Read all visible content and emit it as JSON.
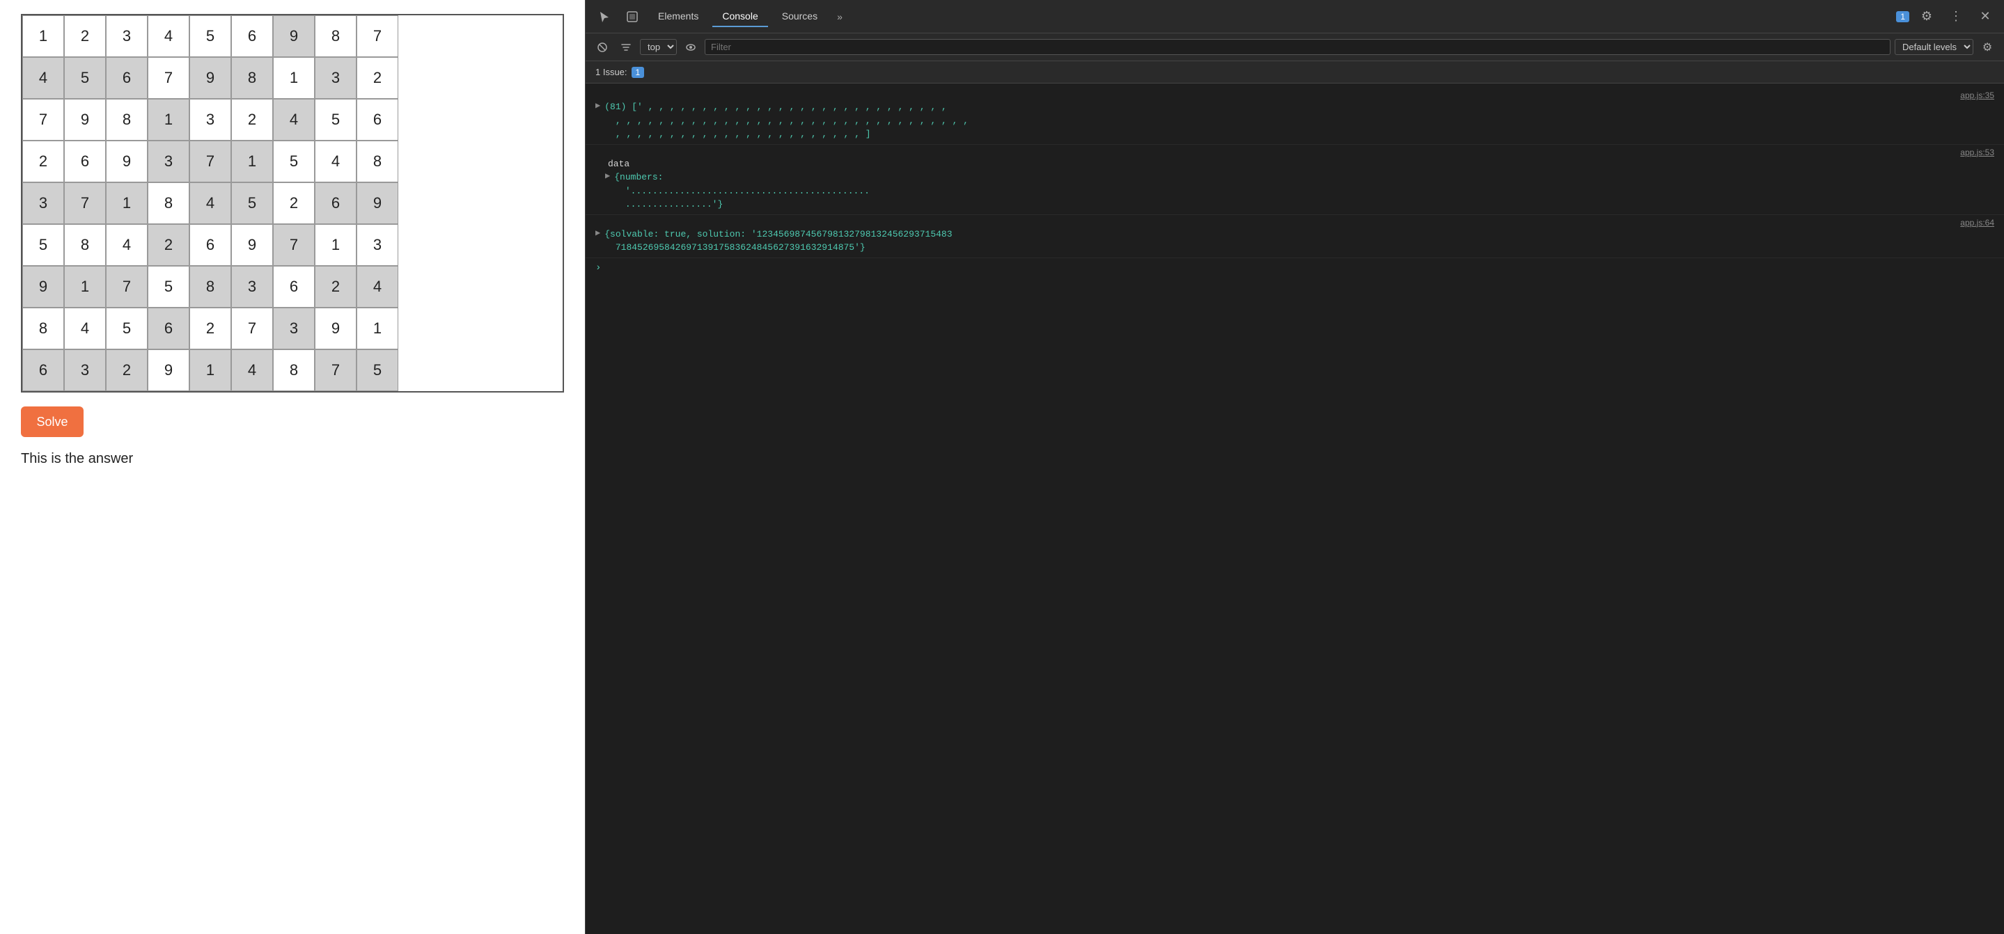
{
  "sudoku": {
    "grid": [
      [
        {
          "val": "1",
          "bg": "white"
        },
        {
          "val": "2",
          "bg": "white"
        },
        {
          "val": "3",
          "bg": "white"
        },
        {
          "val": "4",
          "bg": "white"
        },
        {
          "val": "5",
          "bg": "white"
        },
        {
          "val": "6",
          "bg": "white"
        },
        {
          "val": "9",
          "bg": "gray"
        },
        {
          "val": "8",
          "bg": "white"
        },
        {
          "val": "7",
          "bg": "white"
        }
      ],
      [
        {
          "val": "4",
          "bg": "gray"
        },
        {
          "val": "5",
          "bg": "gray"
        },
        {
          "val": "6",
          "bg": "gray"
        },
        {
          "val": "7",
          "bg": "white"
        },
        {
          "val": "9",
          "bg": "gray"
        },
        {
          "val": "8",
          "bg": "gray"
        },
        {
          "val": "1",
          "bg": "white"
        },
        {
          "val": "3",
          "bg": "gray"
        },
        {
          "val": "2",
          "bg": "white"
        }
      ],
      [
        {
          "val": "7",
          "bg": "white"
        },
        {
          "val": "9",
          "bg": "white"
        },
        {
          "val": "8",
          "bg": "white"
        },
        {
          "val": "1",
          "bg": "gray"
        },
        {
          "val": "3",
          "bg": "white"
        },
        {
          "val": "2",
          "bg": "white"
        },
        {
          "val": "4",
          "bg": "gray"
        },
        {
          "val": "5",
          "bg": "white"
        },
        {
          "val": "6",
          "bg": "white"
        }
      ],
      [
        {
          "val": "2",
          "bg": "white"
        },
        {
          "val": "6",
          "bg": "white"
        },
        {
          "val": "9",
          "bg": "white"
        },
        {
          "val": "3",
          "bg": "gray"
        },
        {
          "val": "7",
          "bg": "gray"
        },
        {
          "val": "1",
          "bg": "gray"
        },
        {
          "val": "5",
          "bg": "white"
        },
        {
          "val": "4",
          "bg": "white"
        },
        {
          "val": "8",
          "bg": "white"
        }
      ],
      [
        {
          "val": "3",
          "bg": "gray"
        },
        {
          "val": "7",
          "bg": "gray"
        },
        {
          "val": "1",
          "bg": "gray"
        },
        {
          "val": "8",
          "bg": "white"
        },
        {
          "val": "4",
          "bg": "gray"
        },
        {
          "val": "5",
          "bg": "gray"
        },
        {
          "val": "2",
          "bg": "white"
        },
        {
          "val": "6",
          "bg": "gray"
        },
        {
          "val": "9",
          "bg": "gray"
        }
      ],
      [
        {
          "val": "5",
          "bg": "white"
        },
        {
          "val": "8",
          "bg": "white"
        },
        {
          "val": "4",
          "bg": "white"
        },
        {
          "val": "2",
          "bg": "gray"
        },
        {
          "val": "6",
          "bg": "white"
        },
        {
          "val": "9",
          "bg": "white"
        },
        {
          "val": "7",
          "bg": "gray"
        },
        {
          "val": "1",
          "bg": "white"
        },
        {
          "val": "3",
          "bg": "white"
        }
      ],
      [
        {
          "val": "9",
          "bg": "gray"
        },
        {
          "val": "1",
          "bg": "gray"
        },
        {
          "val": "7",
          "bg": "gray"
        },
        {
          "val": "5",
          "bg": "white"
        },
        {
          "val": "8",
          "bg": "gray"
        },
        {
          "val": "3",
          "bg": "gray"
        },
        {
          "val": "6",
          "bg": "white"
        },
        {
          "val": "2",
          "bg": "gray"
        },
        {
          "val": "4",
          "bg": "gray"
        }
      ],
      [
        {
          "val": "8",
          "bg": "white"
        },
        {
          "val": "4",
          "bg": "white"
        },
        {
          "val": "5",
          "bg": "white"
        },
        {
          "val": "6",
          "bg": "gray"
        },
        {
          "val": "2",
          "bg": "white"
        },
        {
          "val": "7",
          "bg": "white"
        },
        {
          "val": "3",
          "bg": "gray"
        },
        {
          "val": "9",
          "bg": "white"
        },
        {
          "val": "1",
          "bg": "white"
        }
      ],
      [
        {
          "val": "6",
          "bg": "gray"
        },
        {
          "val": "3",
          "bg": "gray"
        },
        {
          "val": "2",
          "bg": "gray"
        },
        {
          "val": "9",
          "bg": "white"
        },
        {
          "val": "1",
          "bg": "gray"
        },
        {
          "val": "4",
          "bg": "gray"
        },
        {
          "val": "8",
          "bg": "white"
        },
        {
          "val": "7",
          "bg": "gray"
        },
        {
          "val": "5",
          "bg": "gray"
        }
      ]
    ],
    "solve_button": "Solve",
    "answer_text": "This is the answer"
  },
  "devtools": {
    "tabs": [
      "Elements",
      "Console",
      "Sources",
      "»"
    ],
    "active_tab": "Console",
    "badge_count": "1",
    "toolbar": {
      "context": "top",
      "filter_placeholder": "Filter",
      "levels": "Default levels"
    },
    "issues_label": "1 Issue:",
    "issues_count": "1",
    "console_entries": [
      {
        "link": "app.js:35",
        "content_lines": [
          "(81) [' , , , , , , , , , , , , , , , , , , , , , , , , , , , ,",
          " , , , , , , , , , , , , , , , , , , , , , , , , , , , , , , , ,",
          " , , , , , , , , , , , , , , , , , , , , , , , ]"
        ],
        "has_arrow": true
      },
      {
        "link": "app.js:53",
        "content_lines": [
          "data",
          "  {numbers:",
          "  '............................................",
          "  ................'}"
        ],
        "has_arrow": true
      },
      {
        "link": "app.js:64",
        "content_lines": [
          "{solvable: true, solution: '123456987456798132798132456293715483",
          "718452695842697139175836248456273916329148 75'}"
        ],
        "has_arrow": true
      }
    ]
  }
}
